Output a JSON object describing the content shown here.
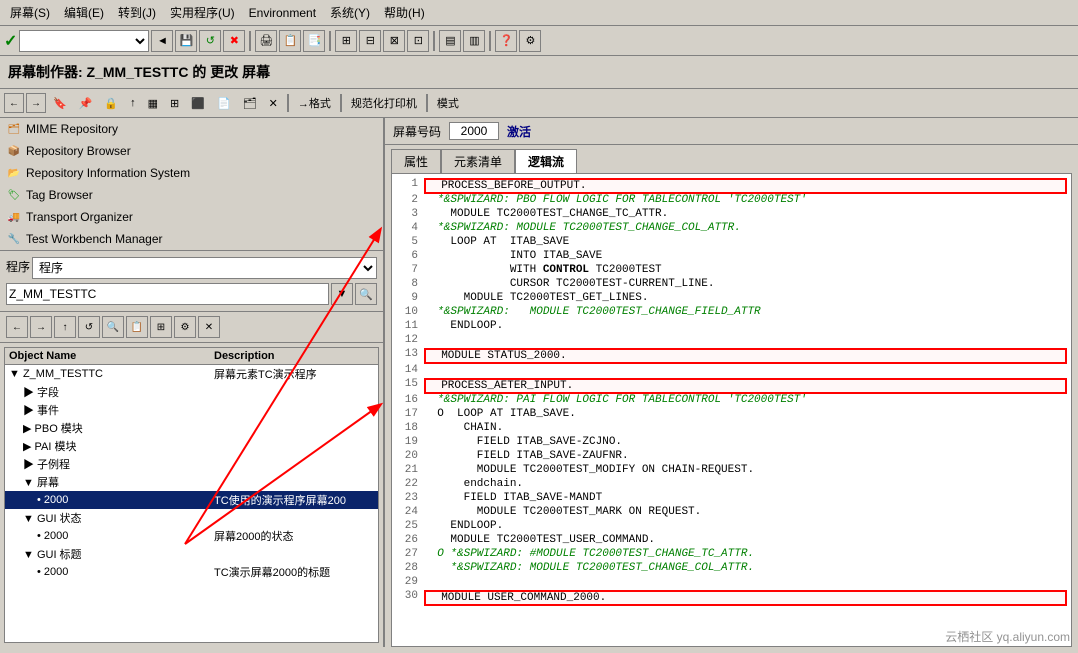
{
  "menubar": {
    "items": [
      "屏幕(S)",
      "编辑(E)",
      "转到(J)",
      "实用程序(U)",
      "Environment",
      "系统(Y)",
      "帮助(H)"
    ]
  },
  "title": "屏幕制作器: Z_MM_TESTTC 的 更改 屏幕",
  "toolbar2": {
    "items": [
      "→格式",
      "规范化打印机",
      "模式"
    ]
  },
  "nav_items": [
    {
      "icon": "mime",
      "label": "MIME Repository"
    },
    {
      "icon": "repo",
      "label": "Repository Browser"
    },
    {
      "icon": "repoi",
      "label": "Repository Information System"
    },
    {
      "icon": "tag",
      "label": "Tag Browser"
    },
    {
      "icon": "transport",
      "label": "Transport Organizer"
    },
    {
      "icon": "test",
      "label": "Test Workbench Manager"
    }
  ],
  "program_label": "程序",
  "program_value": "Z_MM_TESTTC",
  "screen_num_label": "屏幕号码",
  "screen_num_value": "2000",
  "screen_status": "激活",
  "tabs": [
    "属性",
    "元素清单",
    "逻辑流"
  ],
  "active_tab": "逻辑流",
  "tree": {
    "headers": [
      "Object Name",
      "Description"
    ],
    "items": [
      {
        "indent": 0,
        "type": "root",
        "name": "▼ Z_MM_TESTTC",
        "desc": "屏幕元素TC演示程序"
      },
      {
        "indent": 1,
        "type": "folder",
        "name": "▶ 字段",
        "desc": ""
      },
      {
        "indent": 1,
        "type": "folder",
        "name": "▶ 事件",
        "desc": ""
      },
      {
        "indent": 1,
        "type": "folder",
        "name": "▶ PBO 模块",
        "desc": ""
      },
      {
        "indent": 1,
        "type": "folder",
        "name": "▶ PAI 模块",
        "desc": ""
      },
      {
        "indent": 1,
        "type": "folder",
        "name": "▶ 子例程",
        "desc": ""
      },
      {
        "indent": 1,
        "type": "folder-open",
        "name": "▼ 屏幕",
        "desc": ""
      },
      {
        "indent": 2,
        "type": "item",
        "name": "• 2000",
        "desc": "TC使用的演示程序屏幕200",
        "selected": true
      },
      {
        "indent": 1,
        "type": "folder-open",
        "name": "▼ GUI 状态",
        "desc": ""
      },
      {
        "indent": 2,
        "type": "item",
        "name": "• 2000",
        "desc": "屏幕2000的状态"
      },
      {
        "indent": 1,
        "type": "folder-open",
        "name": "▼ GUI 标题",
        "desc": ""
      },
      {
        "indent": 2,
        "type": "item",
        "name": "• 2000",
        "desc": "TC演示屏幕2000的标题"
      }
    ]
  },
  "code_lines": [
    {
      "num": 1,
      "content": "  PROCESS_BEFORE_OUTPUT.",
      "style": "boxed"
    },
    {
      "num": 2,
      "content": "  *&SPWIZARD: PBO FLOW LOGIC FOR TABLECONTROL 'TC2000TEST'",
      "style": "comment"
    },
    {
      "num": 3,
      "content": "    MODULE TC2000TEST_CHANGE_TC_ATTR.",
      "style": "normal"
    },
    {
      "num": 4,
      "content": "  *&SPWIZARD: MODULE TC2000TEST_CHANGE_COL_ATTR.",
      "style": "comment"
    },
    {
      "num": 5,
      "content": "    LOOP AT  ITAB_SAVE",
      "style": "normal"
    },
    {
      "num": 6,
      "content": "             INTO ITAB_SAVE",
      "style": "normal"
    },
    {
      "num": 7,
      "content": "             WITH CONTROL TC2000TEST",
      "style": "normal"
    },
    {
      "num": 8,
      "content": "             CURSOR TC2000TEST-CURRENT_LINE.",
      "style": "normal"
    },
    {
      "num": 9,
      "content": "      MODULE TC2000TEST_GET_LINES.",
      "style": "normal"
    },
    {
      "num": 10,
      "content": "  *&SPWIZARD:   MODULE TC2000TEST_CHANGE_FIELD_ATTR",
      "style": "comment"
    },
    {
      "num": 11,
      "content": "    ENDLOOP.",
      "style": "normal"
    },
    {
      "num": 12,
      "content": "",
      "style": "normal"
    },
    {
      "num": 13,
      "content": "  MODULE STATUS_2000.",
      "style": "boxed"
    },
    {
      "num": 14,
      "content": "",
      "style": "normal"
    },
    {
      "num": 15,
      "content": "  PROCESS_AETER_INPUT.",
      "style": "boxed"
    },
    {
      "num": 16,
      "content": "  *&SPWIZARD: PAI FLOW LOGIC FOR TABLECONTROL 'TC2000TEST'",
      "style": "comment"
    },
    {
      "num": 17,
      "content": "  O  LOOP AT ITAB_SAVE.",
      "style": "normal"
    },
    {
      "num": 18,
      "content": "      CHAIN.",
      "style": "normal"
    },
    {
      "num": 19,
      "content": "        FIELD ITAB_SAVE-ZCJNO.",
      "style": "normal"
    },
    {
      "num": 20,
      "content": "        FIELD ITAB_SAVE-ZAUFNR.",
      "style": "normal"
    },
    {
      "num": 21,
      "content": "        MODULE TC2000TEST_MODIFY ON CHAIN-REQUEST.",
      "style": "normal"
    },
    {
      "num": 22,
      "content": "      endchain.",
      "style": "normal"
    },
    {
      "num": 23,
      "content": "      FIELD ITAB_SAVE-MANDT",
      "style": "normal"
    },
    {
      "num": 24,
      "content": "        MODULE TC2000TEST_MARK ON REQUEST.",
      "style": "normal"
    },
    {
      "num": 25,
      "content": "    ENDLOOP.",
      "style": "normal"
    },
    {
      "num": 26,
      "content": "    MODULE TC2000TEST_USER_COMMAND.",
      "style": "normal"
    },
    {
      "num": 27,
      "content": "  O *&SPWIZARD: #MODULE TC2000TEST_CHANGE_TC_ATTR.",
      "style": "comment"
    },
    {
      "num": 28,
      "content": "    *&SPWIZARD: MODULE TC2000TEST_CHANGE_COL_ATTR.",
      "style": "comment"
    },
    {
      "num": 29,
      "content": "",
      "style": "normal"
    },
    {
      "num": 30,
      "content": "  MODULE USER_COMMAND_2000.",
      "style": "boxed"
    }
  ],
  "watermark": "云栖社区 yq.aliyun.com"
}
